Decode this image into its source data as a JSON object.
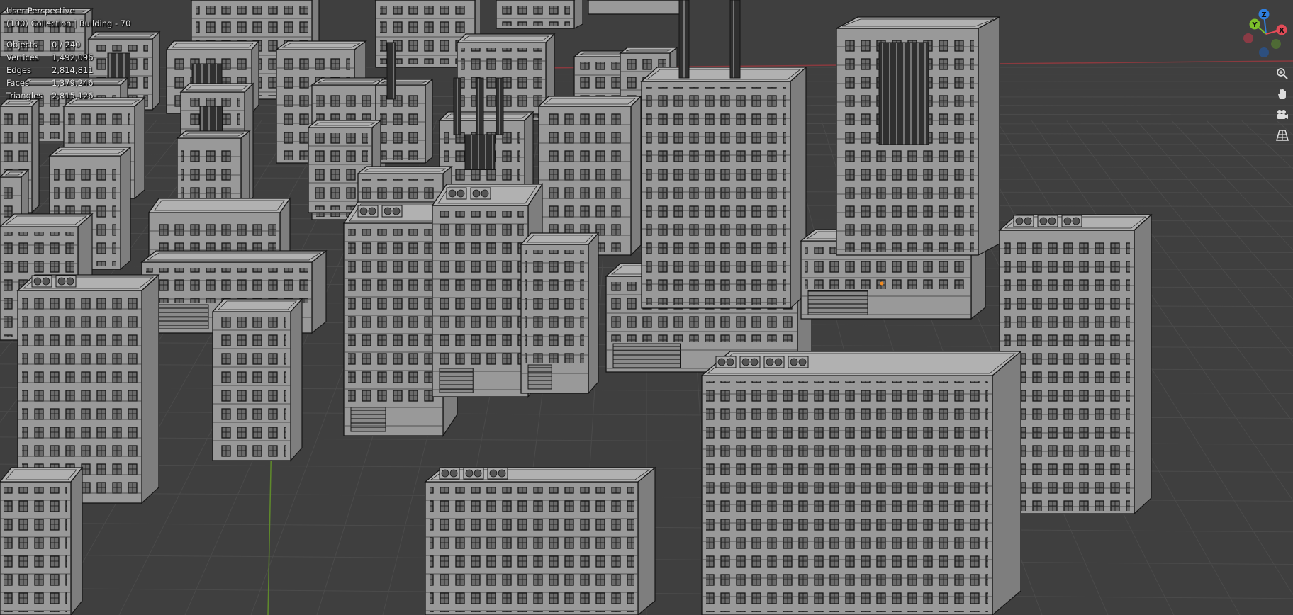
{
  "viewport": {
    "view_name": "User Perspective",
    "context": "(100) Collection | Building - 70",
    "stats": [
      {
        "label": "Objects",
        "value": "0 / 240"
      },
      {
        "label": "Vertices",
        "value": "1,492,096"
      },
      {
        "label": "Edges",
        "value": "2,814,811"
      },
      {
        "label": "Faces",
        "value": "1,379,246"
      },
      {
        "label": "Triangles",
        "value": "2,815,126"
      }
    ]
  },
  "gizmo": {
    "axes": [
      {
        "label": "Z",
        "color": "#2f7fe0"
      },
      {
        "label": "Y",
        "color": "#7cbf2a"
      },
      {
        "label": "X",
        "color": "#e24b57"
      }
    ],
    "tools": [
      {
        "name": "zoom",
        "icon": "magnifier-plus-icon"
      },
      {
        "name": "pan",
        "icon": "hand-icon"
      },
      {
        "name": "camera",
        "icon": "camera-icon"
      },
      {
        "name": "perspective",
        "icon": "grid-perspective-icon"
      }
    ]
  },
  "colors": {
    "background": "#3f3f3f",
    "grid": "#4a4a4a",
    "building_fill": "#9a9a9a",
    "building_side": "#828282",
    "wire": "#1a1a1a"
  }
}
